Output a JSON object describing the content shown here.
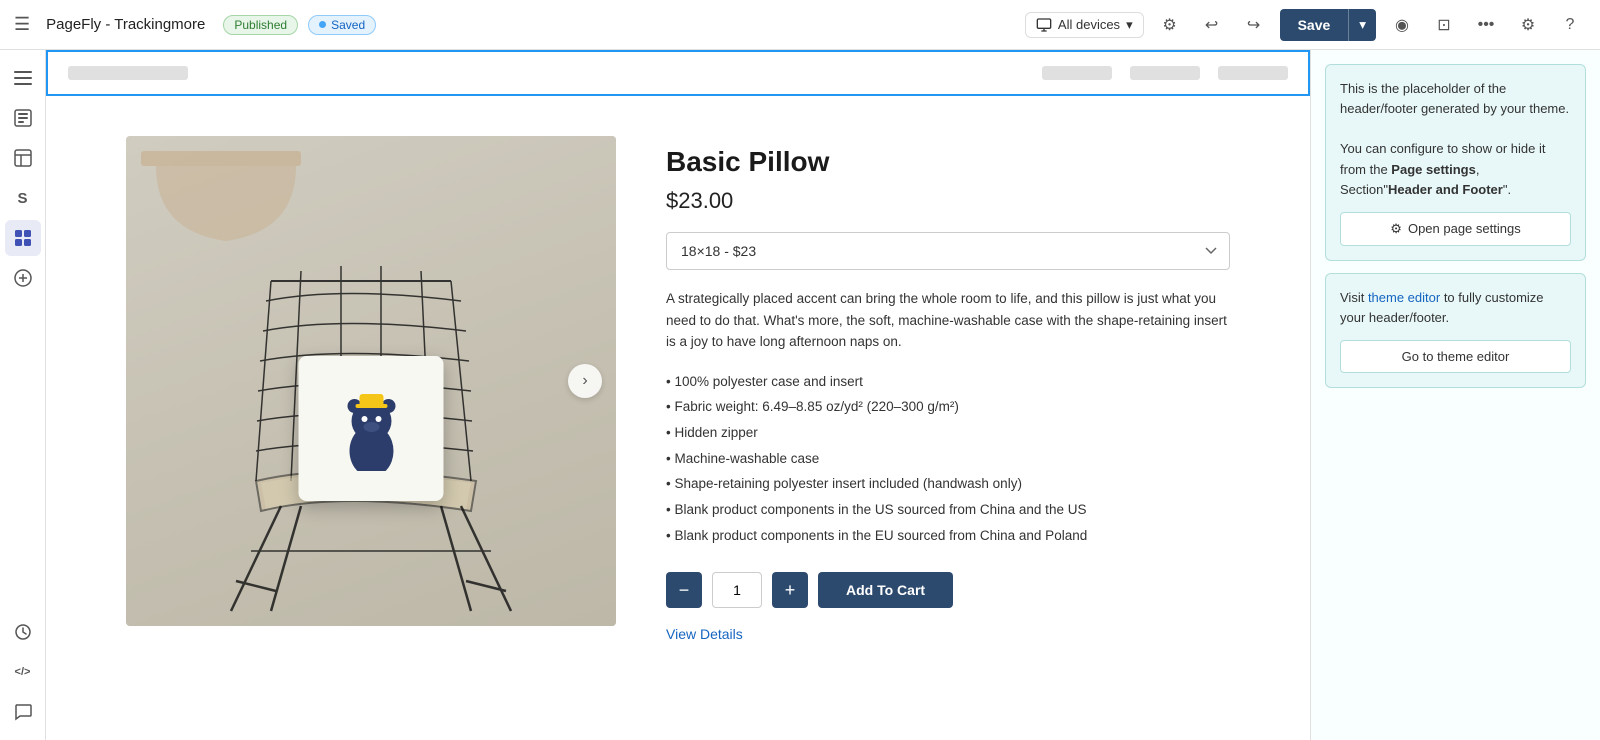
{
  "topbar": {
    "title": "PageFly - Trackingmore",
    "published_label": "Published",
    "saved_label": "Saved",
    "device_label": "All devices",
    "save_button": "Save"
  },
  "header_placeholder": {
    "note": "header placeholder bar"
  },
  "product": {
    "name": "Basic Pillow",
    "price": "$23.00",
    "variant": "18×18 - $23",
    "description": "A strategically placed accent can bring the whole room to life, and this pillow is just what you need to do that. What's more, the soft, machine-washable case with the shape-retaining insert is a joy to have long afternoon naps on.",
    "features": [
      "100% polyester case and insert",
      "Fabric weight: 6.49–8.85 oz/yd² (220–300 g/m²)",
      "Hidden zipper",
      "Machine-washable case",
      "Shape-retaining polyester insert included (handwash only)",
      "Blank product components in the US sourced from China and the US",
      "Blank product components in the EU sourced from China and Poland"
    ],
    "quantity": "1",
    "add_to_cart": "Add To Cart",
    "view_details": "View Details"
  },
  "right_panel": {
    "card1": {
      "text_part1": "This is the placeholder of the header/footer generated by your theme.",
      "text_part2": "You can configure to show or hide it from the ",
      "link1": "Page settings",
      "text_part3": ", Section\"",
      "link2": "Header and Footer",
      "text_part4": "\".",
      "button_label": "Open page settings",
      "gear_icon": "⚙"
    },
    "card2": {
      "text_part1": "Visit theme editor to fully customize your header/footer.",
      "theme_link": "theme editor",
      "button_label": "Go to theme editor"
    }
  },
  "sidebar": {
    "icons": [
      {
        "name": "menu-icon",
        "glyph": "☰"
      },
      {
        "name": "layers-icon",
        "glyph": "⊞"
      },
      {
        "name": "template-icon",
        "glyph": "🖼"
      },
      {
        "name": "shopify-icon",
        "glyph": "S"
      },
      {
        "name": "elements-icon",
        "glyph": "⊟"
      },
      {
        "name": "add-icon",
        "glyph": "+"
      },
      {
        "name": "history-icon",
        "glyph": "⊙"
      },
      {
        "name": "code-icon",
        "glyph": "</>"
      },
      {
        "name": "chat-icon",
        "glyph": "💬"
      }
    ]
  }
}
